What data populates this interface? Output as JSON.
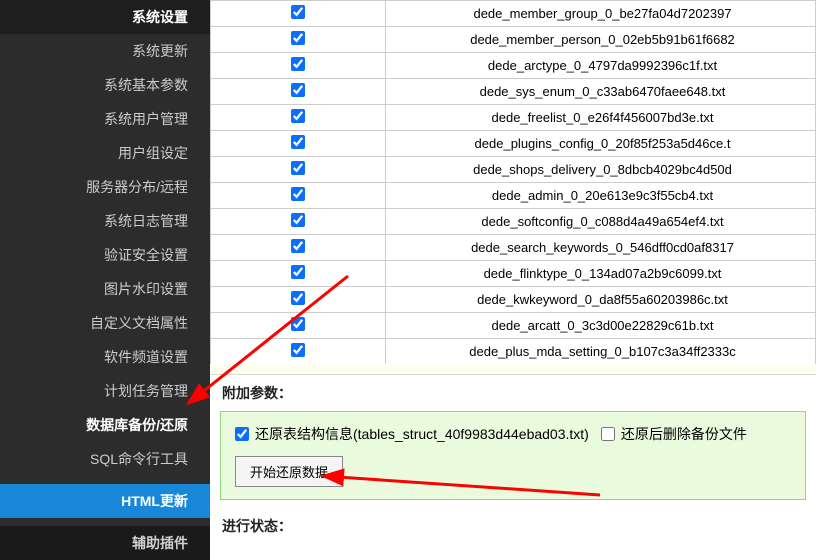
{
  "sidebar": {
    "heading_system": "系统设置",
    "items": [
      "系统更新",
      "系统基本参数",
      "系统用户管理",
      "用户组设定",
      "服务器分布/远程",
      "系统日志管理",
      "验证安全设置",
      "图片水印设置",
      "自定义文档属性",
      "软件频道设置",
      "计划任务管理"
    ],
    "active": "数据库备份/还原",
    "after_active": "SQL命令行工具",
    "heading_html": "HTML更新",
    "heading_plugin": "辅助插件"
  },
  "files": [
    "dede_member_group_0_be27fa04d7202397",
    "dede_member_person_0_02eb5b91b61f6682",
    "dede_arctype_0_4797da9992396c1f.txt",
    "dede_sys_enum_0_c33ab6470faee648.txt",
    "dede_freelist_0_e26f4f456007bd3e.txt",
    "dede_plugins_config_0_20f85f253a5d46ce.t",
    "dede_shops_delivery_0_8dbcb4029bc4d50d",
    "dede_admin_0_20e613e9c3f55cb4.txt",
    "dede_softconfig_0_c088d4a49a654ef4.txt",
    "dede_search_keywords_0_546dff0cd0af8317",
    "dede_flinktype_0_134ad07a2b9c6099.txt",
    "dede_kwkeyword_0_da8f55a60203986c.txt",
    "dede_arcatt_0_3c3d00e22829c61b.txt",
    "dede_plus_mda_setting_0_b107c3a34ff2333c"
  ],
  "labels": {
    "params_title": "附加参数：",
    "restore_struct": "还原表结构信息(tables_struct_40f9983d44ebad03.txt)",
    "delete_after": "还原后删除备份文件",
    "start_restore": "开始还原数据",
    "progress_title": "进行状态："
  }
}
